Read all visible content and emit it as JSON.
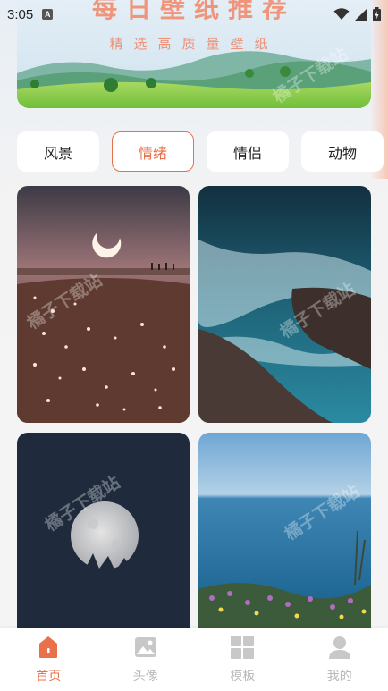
{
  "status_bar": {
    "time": "3:05",
    "app_indicator": "A"
  },
  "banner": {
    "title": "每日壁纸推荐",
    "subtitle": "精选高质量壁纸"
  },
  "categories": [
    {
      "label": "风景",
      "active": false
    },
    {
      "label": "情绪",
      "active": true
    },
    {
      "label": "情侣",
      "active": false
    },
    {
      "label": "动物",
      "active": false
    }
  ],
  "watermark_text": "橘子下载站",
  "wallpapers": [
    {
      "icon": "moon-sea-night-image"
    },
    {
      "icon": "ocean-waves-rocks-image"
    },
    {
      "icon": "full-moon-dark-image"
    },
    {
      "icon": "sea-flowers-image"
    }
  ],
  "bottom_nav": [
    {
      "label": "首页",
      "icon": "home-icon",
      "active": true
    },
    {
      "label": "头像",
      "icon": "image-icon",
      "active": false
    },
    {
      "label": "模板",
      "icon": "grid-icon",
      "active": false
    },
    {
      "label": "我的",
      "icon": "user-icon",
      "active": false
    }
  ],
  "colors": {
    "accent": "#e8704a",
    "inactive": "#b8b8b8",
    "banner_text": "#f0947a"
  }
}
